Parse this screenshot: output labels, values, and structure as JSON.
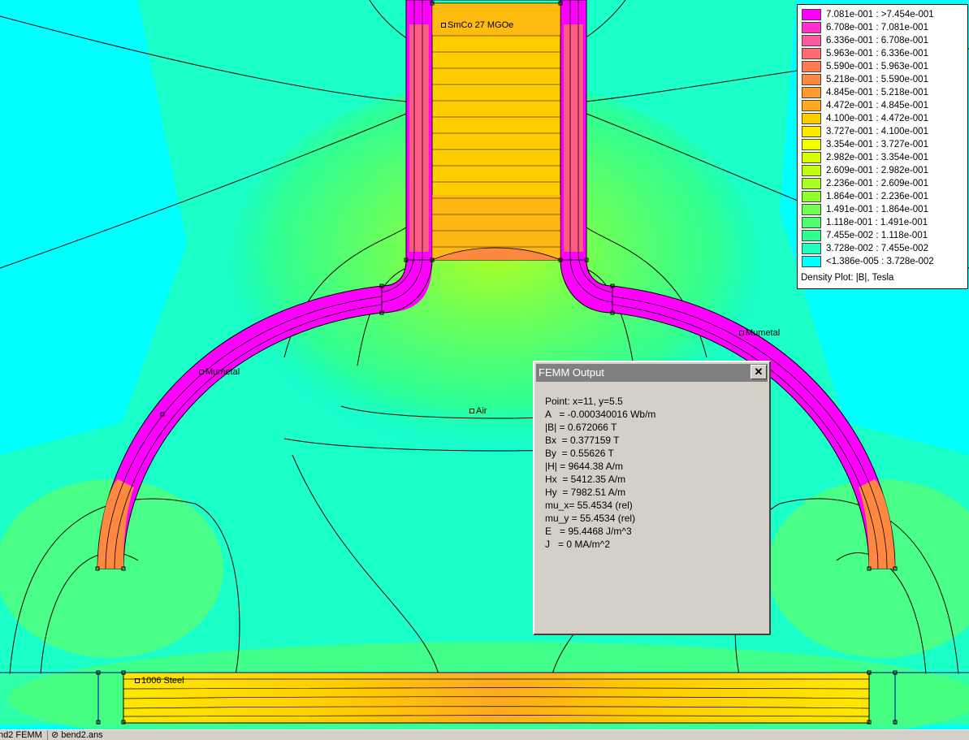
{
  "plot": {
    "labels": {
      "magnet": "SmCo 27 MGOe",
      "mumetal_left": "Mumetal",
      "mumetal_right": "Mumetal",
      "air": "Air",
      "steel": "1006 Steel"
    },
    "colors": {
      "background_air": "#00ffff",
      "magnet_high": "#ff00ff",
      "field_line": "#000000"
    }
  },
  "legend": {
    "title": "Density Plot: |B|, Tesla",
    "entries": [
      {
        "range": "7.081e-001 : >7.454e-001",
        "color": "#ff00ff"
      },
      {
        "range": "6.708e-001 : 7.081e-001",
        "color": "#ff33cc"
      },
      {
        "range": "6.336e-001 : 6.708e-001",
        "color": "#ff5aa0"
      },
      {
        "range": "5.963e-001 : 6.336e-001",
        "color": "#ff6a70"
      },
      {
        "range": "5.590e-001 : 5.963e-001",
        "color": "#ff7a50"
      },
      {
        "range": "5.218e-001 : 5.590e-001",
        "color": "#ff8840"
      },
      {
        "range": "4.845e-001 : 5.218e-001",
        "color": "#ff9a30"
      },
      {
        "range": "4.472e-001 : 4.845e-001",
        "color": "#ffaa20"
      },
      {
        "range": "4.100e-001 : 4.472e-001",
        "color": "#ffcc00"
      },
      {
        "range": "3.727e-001 : 4.100e-001",
        "color": "#ffe800"
      },
      {
        "range": "3.354e-001 : 3.727e-001",
        "color": "#f4ff00"
      },
      {
        "range": "2.982e-001 : 3.354e-001",
        "color": "#d8ff00"
      },
      {
        "range": "2.609e-001 : 2.982e-001",
        "color": "#c0ff10"
      },
      {
        "range": "2.236e-001 : 2.609e-001",
        "color": "#a8ff20"
      },
      {
        "range": "1.864e-001 : 2.236e-001",
        "color": "#90ff30"
      },
      {
        "range": "1.491e-001 : 1.864e-001",
        "color": "#70ff50"
      },
      {
        "range": "1.118e-001 : 1.491e-001",
        "color": "#50ff70"
      },
      {
        "range": "7.455e-002 : 1.118e-001",
        "color": "#30ff90"
      },
      {
        "range": "3.728e-002 : 7.455e-002",
        "color": "#20ffc0"
      },
      {
        "range": "<1.386e-005 : 3.728e-002",
        "color": "#00ffff"
      }
    ]
  },
  "dialog": {
    "title": "FEMM Output",
    "close_label": "✕",
    "lines": [
      "Point: x=11, y=5.5",
      "A   = -0.000340016 Wb/m",
      "|B| = 0.672066 T",
      "Bx  = 0.377159 T",
      "By  = 0.55626 T",
      "|H| = 9644.38 A/m",
      "Hx  = 5412.35 A/m",
      "Hy  = 7982.51 A/m",
      "mu_x= 55.4534 (rel)",
      "mu_y = 55.4534 (rel)",
      "E   = 95.4468 J/m^3",
      "J   = 0 MA/m^2"
    ]
  },
  "taskbar": {
    "tabs": [
      "nd2 FEMM",
      "bend2.ans"
    ]
  }
}
